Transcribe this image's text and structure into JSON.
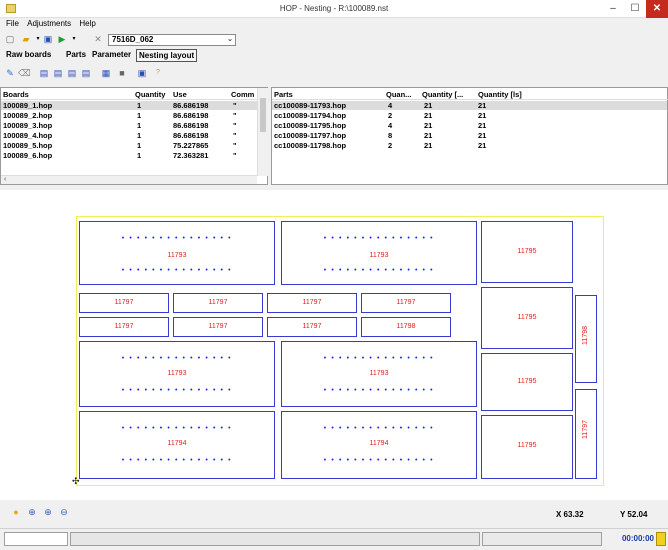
{
  "window": {
    "title": "HOP - Nesting - R:\\100089.nst",
    "min": "–",
    "max": "☐",
    "close": "✕"
  },
  "menu": {
    "file": "File",
    "adjustments": "Adjustments",
    "help": "Help"
  },
  "toolbar": {
    "selected_profile": "7516D_062"
  },
  "tabs": {
    "raw_boards": "Raw boards",
    "parts": "Parts",
    "parameter": "Parameter",
    "nesting_layout": "Nesting layout"
  },
  "boards_table": {
    "headers": {
      "name": "Boards",
      "quantity": "Quantity",
      "use": "Use",
      "comment": "Comm"
    },
    "rows": [
      {
        "name": "100089_1.hop",
        "quantity": "1",
        "use": "86.686198",
        "comment": "\""
      },
      {
        "name": "100089_2.hop",
        "quantity": "1",
        "use": "86.686198",
        "comment": "\""
      },
      {
        "name": "100089_3.hop",
        "quantity": "1",
        "use": "86.686198",
        "comment": "\""
      },
      {
        "name": "100089_4.hop",
        "quantity": "1",
        "use": "86.686198",
        "comment": "\""
      },
      {
        "name": "100089_5.hop",
        "quantity": "1",
        "use": "75.227865",
        "comment": "\""
      },
      {
        "name": "100089_6.hop",
        "quantity": "1",
        "use": "72.363281",
        "comment": "\""
      }
    ]
  },
  "parts_table": {
    "headers": {
      "name": "Parts",
      "quantity": "Quan...",
      "quantity_l": "Quantity [...",
      "quantity_ls": "Quantity [ls]"
    },
    "rows": [
      {
        "name": "cc100089-11793.hop",
        "quantity": "4",
        "quantity_l": "21",
        "quantity_ls": "21"
      },
      {
        "name": "cc100089-11794.hop",
        "quantity": "2",
        "quantity_l": "21",
        "quantity_ls": "21"
      },
      {
        "name": "cc100089-11795.hop",
        "quantity": "4",
        "quantity_l": "21",
        "quantity_ls": "21"
      },
      {
        "name": "cc100089-11797.hop",
        "quantity": "8",
        "quantity_l": "21",
        "quantity_ls": "21"
      },
      {
        "name": "cc100089-11798.hop",
        "quantity": "2",
        "quantity_l": "21",
        "quantity_ls": "21"
      }
    ]
  },
  "nesting": {
    "labels": {
      "p11793": "11793",
      "p11794": "11794",
      "p11795": "11795",
      "p11797": "11797",
      "p11798": "11798"
    },
    "dots_long": "• • • • • • • • • • • • • • •",
    "dots_short": "• •"
  },
  "coords": {
    "x": "X 63.32",
    "y": "Y 52.04"
  },
  "status": {
    "timer": "00:00:00"
  },
  "colors": {
    "part_border": "#3a3ad0",
    "part_label": "#e02020",
    "board_border": "#f2ee5a"
  }
}
